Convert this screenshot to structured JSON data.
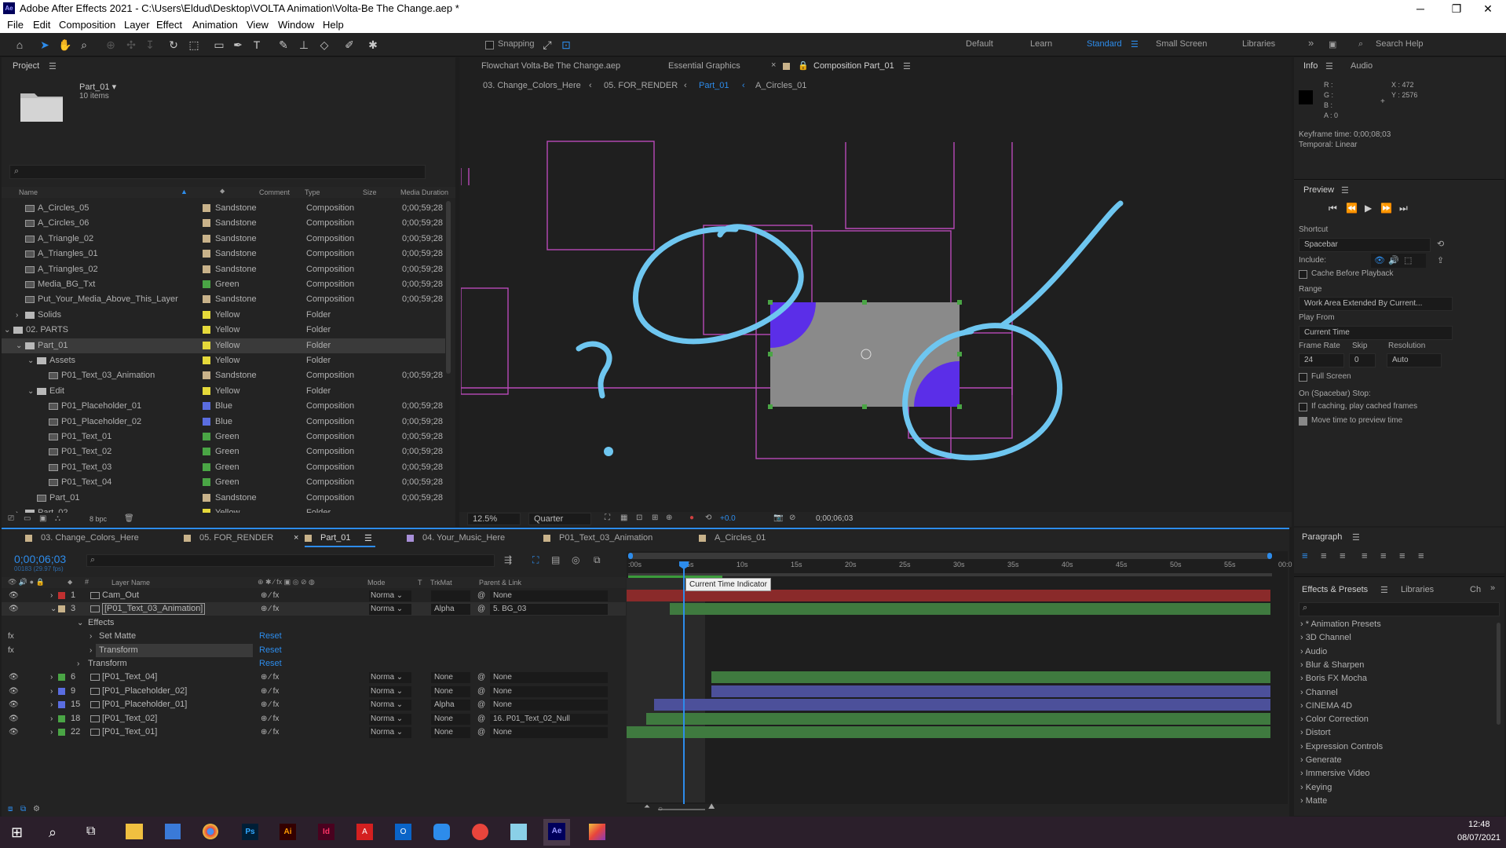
{
  "window": {
    "title": "Adobe After Effects 2021 - C:\\Users\\Eldud\\Desktop\\VOLTA Animation\\Volta-Be The Change.aep *",
    "logo": "Ae"
  },
  "menu": [
    "File",
    "Edit",
    "Composition",
    "Layer",
    "Effect",
    "Animation",
    "View",
    "Window",
    "Help"
  ],
  "toolbar": {
    "snapping": "Snapping",
    "workspaces": [
      "Default",
      "Learn",
      "Standard",
      "Small Screen",
      "Libraries"
    ],
    "search_placeholder": "Search Help"
  },
  "project": {
    "tab": "Project",
    "selected_name": "Part_01 ▾",
    "selected_count": "10 items",
    "columns": [
      "Name",
      "Comment",
      "Type",
      "Size",
      "Media Duration"
    ],
    "items": [
      {
        "name": "A_Circles_05",
        "label": "Sandstone",
        "color": "#c8b28a",
        "type": "Composition",
        "dur": "0;00;59;28",
        "indent": 0,
        "kind": "comp"
      },
      {
        "name": "A_Circles_06",
        "label": "Sandstone",
        "color": "#c8b28a",
        "type": "Composition",
        "dur": "0;00;59;28",
        "indent": 0,
        "kind": "comp"
      },
      {
        "name": "A_Triangle_02",
        "label": "Sandstone",
        "color": "#c8b28a",
        "type": "Composition",
        "dur": "0;00;59;28",
        "indent": 0,
        "kind": "comp"
      },
      {
        "name": "A_Triangles_01",
        "label": "Sandstone",
        "color": "#c8b28a",
        "type": "Composition",
        "dur": "0;00;59;28",
        "indent": 0,
        "kind": "comp"
      },
      {
        "name": "A_Triangles_02",
        "label": "Sandstone",
        "color": "#c8b28a",
        "type": "Composition",
        "dur": "0;00;59;28",
        "indent": 0,
        "kind": "comp"
      },
      {
        "name": "Media_BG_Txt",
        "label": "Green",
        "color": "#4aa545",
        "type": "Composition",
        "dur": "0;00;59;28",
        "indent": 0,
        "kind": "comp"
      },
      {
        "name": "Put_Your_Media_Above_This_Layer",
        "label": "Sandstone",
        "color": "#c8b28a",
        "type": "Composition",
        "dur": "0;00;59;28",
        "indent": 0,
        "kind": "comp"
      },
      {
        "name": "Solids",
        "label": "Yellow",
        "color": "#e5d93a",
        "type": "Folder",
        "dur": "",
        "indent": 0,
        "kind": "folder",
        "tw": "›"
      },
      {
        "name": "02. PARTS",
        "label": "Yellow",
        "color": "#e5d93a",
        "type": "Folder",
        "dur": "",
        "indent": -1,
        "kind": "folder",
        "tw": "⌄"
      },
      {
        "name": "Part_01",
        "label": "Yellow",
        "color": "#e5d93a",
        "type": "Folder",
        "dur": "",
        "indent": 0,
        "kind": "folder",
        "tw": "⌄",
        "sel": true
      },
      {
        "name": "Assets",
        "label": "Yellow",
        "color": "#e5d93a",
        "type": "Folder",
        "dur": "",
        "indent": 1,
        "kind": "folder",
        "tw": "⌄"
      },
      {
        "name": "P01_Text_03_Animation",
        "label": "Sandstone",
        "color": "#c8b28a",
        "type": "Composition",
        "dur": "0;00;59;28",
        "indent": 2,
        "kind": "comp"
      },
      {
        "name": "Edit",
        "label": "Yellow",
        "color": "#e5d93a",
        "type": "Folder",
        "dur": "",
        "indent": 1,
        "kind": "folder",
        "tw": "⌄"
      },
      {
        "name": "P01_Placeholder_01",
        "label": "Blue",
        "color": "#5a6de0",
        "type": "Composition",
        "dur": "0;00;59;28",
        "indent": 2,
        "kind": "comp"
      },
      {
        "name": "P01_Placeholder_02",
        "label": "Blue",
        "color": "#5a6de0",
        "type": "Composition",
        "dur": "0;00;59;28",
        "indent": 2,
        "kind": "comp"
      },
      {
        "name": "P01_Text_01",
        "label": "Green",
        "color": "#4aa545",
        "type": "Composition",
        "dur": "0;00;59;28",
        "indent": 2,
        "kind": "comp"
      },
      {
        "name": "P01_Text_02",
        "label": "Green",
        "color": "#4aa545",
        "type": "Composition",
        "dur": "0;00;59;28",
        "indent": 2,
        "kind": "comp"
      },
      {
        "name": "P01_Text_03",
        "label": "Green",
        "color": "#4aa545",
        "type": "Composition",
        "dur": "0;00;59;28",
        "indent": 2,
        "kind": "comp"
      },
      {
        "name": "P01_Text_04",
        "label": "Green",
        "color": "#4aa545",
        "type": "Composition",
        "dur": "0;00;59;28",
        "indent": 2,
        "kind": "comp"
      },
      {
        "name": "Part_01",
        "label": "Sandstone",
        "color": "#c8b28a",
        "type": "Composition",
        "dur": "0;00;59;28",
        "indent": 1,
        "kind": "comp"
      },
      {
        "name": "Part_02",
        "label": "Yellow",
        "color": "#e5d93a",
        "type": "Folder",
        "dur": "",
        "indent": 0,
        "kind": "folder",
        "tw": "›"
      }
    ],
    "bpc": "8 bpc"
  },
  "comp_viewer": {
    "tabs": [
      "Flowchart  Volta-Be The Change.aep",
      "Essential Graphics",
      "Composition  Part_01"
    ],
    "breadcrumbs": [
      "03. Change_Colors_Here",
      "05. FOR_RENDER",
      "Part_01",
      "A_Circles_01"
    ],
    "zoom": "12.5%",
    "resolution": "Quarter",
    "exposure": "+0.0",
    "timecode": "0;00;06;03",
    "annotation_mark": "?"
  },
  "info": {
    "tabs": [
      "Info",
      "Audio"
    ],
    "rgba": [
      "R :",
      "G :",
      "B :",
      "A : 0"
    ],
    "xy": [
      "X : 472",
      "Y : 2576"
    ],
    "keyframe_time": "Keyframe time: 0;00;08;03",
    "temporal": "Temporal: Linear"
  },
  "preview": {
    "title": "Preview",
    "shortcut_label": "Shortcut",
    "shortcut": "Spacebar",
    "include_label": "Include:",
    "cache_before": "Cache Before Playback",
    "range_label": "Range",
    "range": "Work Area Extended By Current...",
    "play_from_label": "Play From",
    "play_from": "Current Time",
    "frame_rate_label": "Frame Rate",
    "skip_label": "Skip",
    "resolution_label": "Resolution",
    "frame_rate": "24",
    "skip": "0",
    "resolution": "Auto",
    "full_screen": "Full Screen",
    "stop_label": "On (Spacebar) Stop:",
    "cached_frames": "If caching, play cached frames",
    "move_time": "Move time to preview time"
  },
  "timeline": {
    "tabs": [
      {
        "name": "03. Change_Colors_Here",
        "color": "#c8b28a"
      },
      {
        "name": "05. FOR_RENDER",
        "color": "#c8b28a"
      },
      {
        "name": "Part_01",
        "color": "#c8b28a",
        "active": true
      },
      {
        "name": "04. Your_Music_Here",
        "color": "#a88fd8"
      },
      {
        "name": "P01_Text_03_Animation",
        "color": "#c8b28a"
      },
      {
        "name": "A_Circles_01",
        "color": "#c8b28a"
      }
    ],
    "timecode": "0;00;06;03",
    "frame_info": "00183 (29.97 fps)",
    "search_placeholder": "",
    "col_headers": {
      "layer_name": "Layer Name",
      "mode": "Mode",
      "t": "T",
      "trkmat": "TrkMat",
      "parent": "Parent & Link"
    },
    "ruler": [
      ":00s",
      "05s",
      "10s",
      "15s",
      "20s",
      "25s",
      "30s",
      "35s",
      "40s",
      "45s",
      "50s",
      "55s",
      "00:0"
    ],
    "tooltip": "Current Time Indicator",
    "layers": [
      {
        "num": "1",
        "name": "Cam_Out",
        "color": "#c03030",
        "mode": "Norma",
        "trk": "",
        "parent": "None",
        "bar": "#8a2a2a"
      },
      {
        "num": "3",
        "name": "[P01_Text_03_Animation]",
        "color": "#c8b28a",
        "mode": "Norma",
        "trk": "Alpha",
        "parent": "5. BG_03",
        "bar": "#3f7a3f",
        "sel": true
      },
      {
        "num": "6",
        "name": "[P01_Text_04]",
        "color": "#4aa545",
        "mode": "Norma",
        "trk": "None",
        "parent": "None",
        "bar": "#3f7a3f"
      },
      {
        "num": "9",
        "name": "[P01_Placeholder_02]",
        "color": "#5a6de0",
        "mode": "Norma",
        "trk": "None",
        "parent": "None",
        "bar": "#4c509a"
      },
      {
        "num": "15",
        "name": "[P01_Placeholder_01]",
        "color": "#5a6de0",
        "mode": "Norma",
        "trk": "Alpha",
        "parent": "None",
        "bar": "#4c509a"
      },
      {
        "num": "18",
        "name": "[P01_Text_02]",
        "color": "#4aa545",
        "mode": "Norma",
        "trk": "None",
        "parent": "16. P01_Text_02_Null",
        "bar": "#3f7a3f"
      },
      {
        "num": "22",
        "name": "[P01_Text_01]",
        "color": "#4aa545",
        "mode": "Norma",
        "trk": "None",
        "parent": "None",
        "bar": "#3f7a3f"
      }
    ],
    "effects": {
      "label": "Effects",
      "items": [
        "Set Matte",
        "Transform"
      ],
      "reset": "Reset",
      "transform": "Transform"
    }
  },
  "paragraph": {
    "title": "Paragraph"
  },
  "effects_presets": {
    "tabs": [
      "Effects & Presets",
      "Libraries",
      "Ch"
    ],
    "items": [
      "* Animation Presets",
      "3D Channel",
      "Audio",
      "Blur & Sharpen",
      "Boris FX Mocha",
      "Channel",
      "CINEMA 4D",
      "Color Correction",
      "Distort",
      "Expression Controls",
      "Generate",
      "Immersive Video",
      "Keying",
      "Matte"
    ]
  },
  "taskbar": {
    "time": "12:48",
    "date": "08/07/2021"
  },
  "colors": {
    "accent": "#2d8ceb",
    "shape_purple": "#5b2ee8",
    "annotation": "#6ec6f0",
    "guide": "#b84ab8"
  }
}
